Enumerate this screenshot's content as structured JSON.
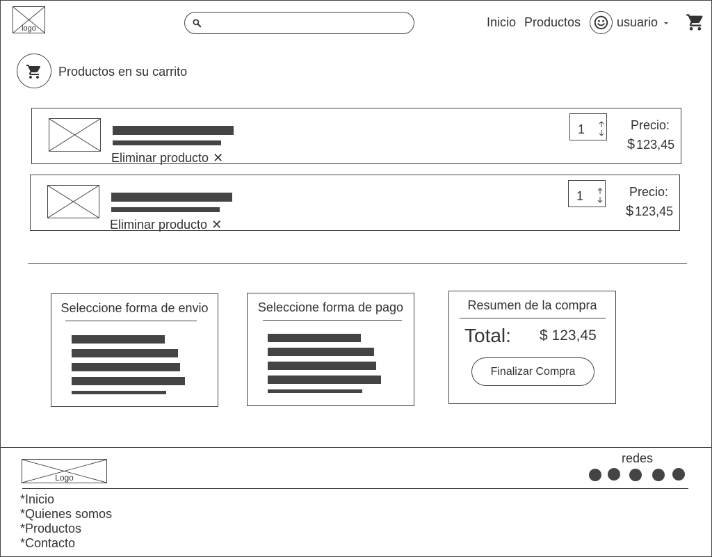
{
  "header": {
    "logo_text": "logo",
    "search": {
      "placeholder": "",
      "value": ""
    },
    "nav": [
      {
        "label": "Inicio"
      },
      {
        "label": "Productos"
      }
    ],
    "user": {
      "label": "usuario"
    }
  },
  "cart": {
    "title": "Productos en su carrito",
    "items": [
      {
        "quantity": "1",
        "remove_label": "Eliminar producto",
        "remove_icon": "✕",
        "price_label": "Precio:",
        "currency": "$",
        "price": "123,45"
      },
      {
        "quantity": "1",
        "remove_label": "Eliminar producto",
        "remove_icon": "✕",
        "price_label": "Precio:",
        "currency": "$",
        "price": "123,45"
      }
    ]
  },
  "shipping": {
    "title": "Seleccione forma de envio"
  },
  "payment": {
    "title": "Seleccione forma de pago"
  },
  "summary": {
    "title": "Resumen de la compra",
    "total_label": "Total:",
    "currency": "$",
    "total_value": "123,45",
    "finish_label": "Finalizar Compra"
  },
  "footer": {
    "logo_text": "Logo",
    "social_label": "redes",
    "links": [
      {
        "label": "*Inicio"
      },
      {
        "label": "*Quienes somos"
      },
      {
        "label": "*Productos"
      },
      {
        "label": "*Contacto"
      }
    ]
  },
  "icons": {
    "search": "search-icon",
    "user": "smiley-icon",
    "cart": "cart-icon",
    "caret": "caret-down-icon",
    "qty_arrows": "up-down-arrows-icon"
  },
  "colors": {
    "stroke": "#444444",
    "text": "#333333",
    "background": "#ffffff"
  }
}
